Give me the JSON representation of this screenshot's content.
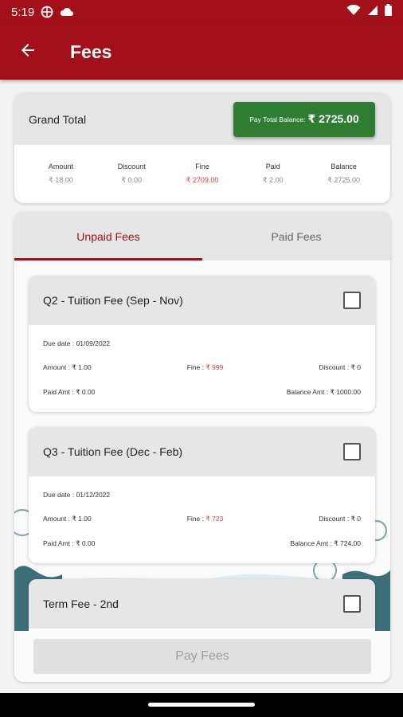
{
  "status_bar": {
    "time": "5:19",
    "icons": [
      "vpn-globe-icon",
      "cloud-icon",
      "wifi-icon",
      "signal-icon",
      "battery-icon"
    ]
  },
  "app_bar": {
    "title": "Fees",
    "back_icon": "arrow-left-icon"
  },
  "grand_total": {
    "label": "Grand Total",
    "pay_button": {
      "prefix": "Pay Total Balance:",
      "amount": "₹ 2725.00"
    },
    "summary": [
      {
        "label": "Amount",
        "value": "₹ 18.00"
      },
      {
        "label": "Discount",
        "value": "₹ 0.00"
      },
      {
        "label": "Fine",
        "value": "₹ 2709.00"
      },
      {
        "label": "Paid",
        "value": "₹ 2.00"
      },
      {
        "label": "Balance",
        "value": "₹ 2725.00"
      }
    ]
  },
  "tabs": [
    {
      "label": "Unpaid Fees",
      "active": true
    },
    {
      "label": "Paid Fees",
      "active": false
    }
  ],
  "fees": [
    {
      "name": "Q2 - Tuition Fee (Sep - Nov)",
      "due_date": "Due date : 01/09/2022",
      "amount": "Amount : ₹ 1.00",
      "fine_label": "Fine :",
      "fine_value": "₹ 999",
      "discount": "Discount : ₹ 0",
      "paid": "Paid Amt : ₹ 0.00",
      "balance": "Balance Amt : ₹ 1000.00"
    },
    {
      "name": "Q3 - Tuition Fee (Dec - Feb)",
      "due_date": "Due date : 01/12/2022",
      "amount": "Amount : ₹ 1.00",
      "fine_label": "Fine :",
      "fine_value": "₹ 723",
      "discount": "Discount : ₹ 0",
      "paid": "Paid Amt : ₹ 0.00",
      "balance": "Balance Amt : ₹ 724.00"
    },
    {
      "name": "Term Fee - 2nd"
    }
  ],
  "pay_fees_button": "Pay Fees",
  "colors": {
    "brand": "#a3101a",
    "pay_green": "#2e7d32",
    "fine_red": "#e53935"
  }
}
